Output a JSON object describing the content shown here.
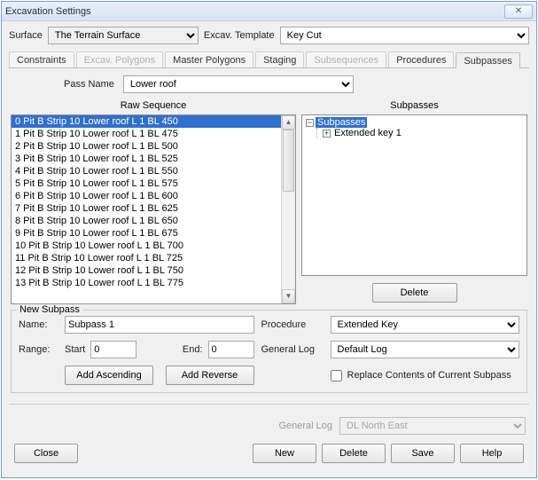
{
  "window": {
    "title": "Excavation Settings"
  },
  "topbar": {
    "surface_label": "Surface",
    "surface_value": "The Terrain Surface",
    "template_label": "Excav. Template",
    "template_value": "Key Cut"
  },
  "tabs": {
    "items": [
      {
        "label": "Constraints",
        "state": "active"
      },
      {
        "label": "Excav. Polygons",
        "state": "disabled"
      },
      {
        "label": "Master Polygons",
        "state": "normal"
      },
      {
        "label": "Staging",
        "state": "normal"
      },
      {
        "label": "Subsequences",
        "state": "disabled"
      },
      {
        "label": "Procedures",
        "state": "normal"
      },
      {
        "label": "Subpasses",
        "state": "normal"
      }
    ]
  },
  "passname": {
    "label": "Pass Name",
    "value": "Lower roof"
  },
  "raw_seq": {
    "header": "Raw Sequence",
    "items": [
      "0  Pit B Strip 10 Lower roof L  1 BL 450",
      "1  Pit B Strip 10 Lower roof L  1 BL 475",
      "2  Pit B Strip 10 Lower roof L  1 BL 500",
      "3  Pit B Strip 10 Lower roof L  1 BL 525",
      "4  Pit B Strip 10 Lower roof L  1 BL 550",
      "5  Pit B Strip 10 Lower roof L  1 BL 575",
      "6  Pit B Strip 10 Lower roof L  1 BL 600",
      "7  Pit B Strip 10 Lower roof L  1 BL 625",
      "8  Pit B Strip 10 Lower roof L  1 BL 650",
      "9  Pit B Strip 10 Lower roof L  1 BL 675",
      "10  Pit B Strip 10 Lower roof L  1 BL 700",
      "11  Pit B Strip 10 Lower roof L  1 BL 725",
      "12  Pit B Strip 10 Lower roof L  1 BL 750",
      "13  Pit B Strip 10 Lower roof L  1 BL 775"
    ]
  },
  "subpasses": {
    "header": "Subpasses",
    "root": "Subpasses",
    "child": "Extended key 1",
    "delete_btn": "Delete"
  },
  "newsub": {
    "legend": "New Subpass",
    "name_label": "Name:",
    "name_value": "Subpass 1",
    "range_label": "Range:",
    "start_label": "Start",
    "start_value": "0",
    "end_label": "End:",
    "end_value": "0",
    "procedure_label": "Procedure",
    "procedure_value": "Extended Key",
    "genlog_label": "General Log",
    "genlog_value": "Default Log",
    "add_asc": "Add Ascending",
    "add_rev": "Add Reverse",
    "replace_label": "Replace Contents of Current Subpass"
  },
  "footer": {
    "genlog_label": "General Log",
    "genlog_value": "DL North East",
    "close": "Close",
    "new": "New",
    "delete": "Delete",
    "save": "Save",
    "help": "Help"
  }
}
